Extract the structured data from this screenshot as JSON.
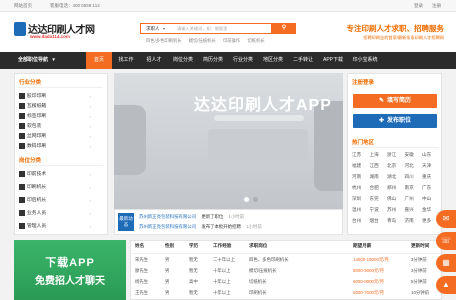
{
  "topbar": {
    "home": "网站首页",
    "hotline": "客服电话：400 0559 114",
    "login": "登录",
    "register": "注册"
  },
  "header": {
    "logo_text": "达达印刷人才网",
    "logo_url": "www.dada114.com",
    "search_option": "求职人",
    "search_placeholder": "请输入关键词，如：制版里",
    "search_button": "",
    "hot_links": [
      "四色/多色印刷机长",
      "模切/压痕机长",
      "印前操作",
      "切纸机长"
    ],
    "slogan": "专注印刷人才求职、招聘服务",
    "sub_slogan": "招聘印刷业的首家/最新条条印刷人才招聘网"
  },
  "nav": {
    "all": "全部职位导航",
    "items": [
      "首页",
      "找工作",
      "招人才",
      "岗位分类",
      "简历分类",
      "行业分类",
      "地区分类",
      "二手转让",
      "APP下载",
      "印小宝系统"
    ]
  },
  "sidebar": {
    "industry_title": "行业分类",
    "industry": [
      "胶印印刷",
      "瓦楞纸箱",
      "标签印刷",
      "软包装",
      "丝网印刷",
      "数码印刷"
    ],
    "position_title": "岗位分类",
    "positions": [
      "印前技术",
      "印刷机长",
      "印后机长",
      "业务人员",
      "管理人员"
    ]
  },
  "banner": {
    "title": "达达印刷人才APP",
    "sub1": "",
    "sub2": ""
  },
  "news": {
    "tag": "最新动态",
    "items": [
      {
        "company": "苏州新正亮包装科技有限公司",
        "action": "更新了职位",
        "time": "1小时前"
      },
      {
        "company": "苏州新正亮包装科技有限公司",
        "action": "发布了本批开始招聘",
        "time": "1小时前"
      }
    ]
  },
  "right": {
    "login_title": "注册登录",
    "btn_resume": "填写简历",
    "btn_job": "发布职位",
    "cities_title": "热门地区",
    "cities": [
      "江苏",
      "上海",
      "浙江",
      "安徽",
      "山东",
      "福建",
      "江西",
      "北京",
      "河北",
      "天津",
      "河南",
      "湖南",
      "湖北",
      "四川",
      "重庆",
      "杭州",
      "合肥",
      "郑州",
      "南京",
      "广东",
      "深圳",
      "东莞",
      "佛山",
      "广州",
      "中山",
      "温州",
      "宁波",
      "苏州",
      "嘉兴",
      "金华",
      "台州",
      "烟台",
      "青岛",
      "济南",
      "更多"
    ]
  },
  "app": {
    "title": "下载APP",
    "subtitle": "免费招人才聊天"
  },
  "table": {
    "headers": [
      "姓名",
      "性别",
      "学历",
      "工作经验",
      "求职岗位",
      "期望月薪",
      "更新时间"
    ],
    "rows": [
      [
        "宋先生",
        "男",
        "暂无",
        "二十年以上",
        "四色、多色印刷机长",
        "14000-19000元/月",
        "3分钟前"
      ],
      [
        "廖先生",
        "男",
        "暂无",
        "十年以上",
        "模切/压痕机长",
        "8000-9000元/月",
        "3分钟前"
      ],
      [
        "杨先生",
        "男",
        "高中",
        "十年以上",
        "切纸机长",
        "6000-8000元/月",
        "5分钟前"
      ],
      [
        "王先生",
        "男",
        "暂无",
        "十年以上",
        "印刷机长",
        "6000-7000元/月",
        "10分钟前"
      ]
    ]
  },
  "colors": {
    "accent": "#f36c21",
    "nav_bg": "#2b2b2b",
    "title_orange": "#ef6c00"
  }
}
